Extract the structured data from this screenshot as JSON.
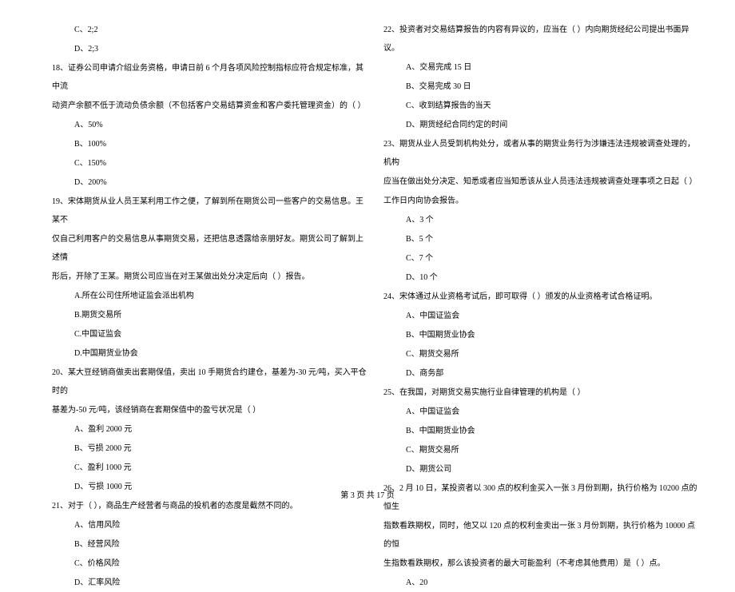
{
  "col_left": {
    "lead_opts": [
      "C、2;2",
      "D、2;3"
    ],
    "q18": {
      "stem_lines": [
        "18、证券公司申请介绍业务资格，申请日前 6 个月各项风险控制指标应符合规定标准，其中流",
        "动资产余额不低于流动负债余额（不包括客户交易结算资金和客户委托管理资金）的（    ）"
      ],
      "opts": [
        "A、50%",
        "B、100%",
        "C、150%",
        "D、200%"
      ]
    },
    "q19": {
      "stem_lines": [
        "19、宋体期货从业人员王某利用工作之便，了解到所在期货公司一些客户的交易信息。王某不",
        "仅自己利用客户的交易信息从事期货交易，还把信息透露给亲朋好友。期货公司了解到上述情",
        "形后，开除了王某。期货公司应当在对王某做出处分决定后向（    ）报告。"
      ],
      "opts": [
        "A.所在公司住所地证监会派出机构",
        "B.期货交易所",
        "C.中国证监会",
        "D.中国期货业协会"
      ]
    },
    "q20": {
      "stem_lines": [
        "20、某大豆经销商做卖出套期保值，卖出 10 手期货合约建仓，基差为-30 元/吨，买入平仓时的",
        "基差为-50 元/吨，该经销商在套期保值中的盈亏状况是（    ）"
      ],
      "opts": [
        "A、盈利 2000 元",
        "B、亏损 2000 元",
        "C、盈利 1000 元",
        "D、亏损 1000 元"
      ]
    },
    "q21": {
      "stem_lines": [
        "21、对于（    ），商品生产经营者与商品的投机者的态度是截然不同的。"
      ],
      "opts": [
        "A、信用风险",
        "B、经营风险",
        "C、价格风险",
        "D、汇率风险"
      ]
    }
  },
  "col_right": {
    "q22": {
      "stem_lines": [
        "22、投资者对交易结算报告的内容有异议的，应当在（    ）内向期货经纪公司提出书面异议。"
      ],
      "opts": [
        "A、交易完成 15 日",
        "B、交易完成 30 日",
        "C、收到结算报告的当天",
        "D、期货经纪合同约定的时间"
      ]
    },
    "q23": {
      "stem_lines": [
        "23、期货从业人员受到机构处分，或者从事的期货业务行为涉嫌违法违规被调查处理的，机构",
        "应当在做出处分决定、知悉或者应当知悉该从业人员违法违规被调查处理事项之日起（     ）",
        "工作日内向协会报告。"
      ],
      "opts": [
        "A、3 个",
        "B、5 个",
        "C、7 个",
        "D、10 个"
      ]
    },
    "q24": {
      "stem_lines": [
        "24、宋体通过从业资格考试后，即可取得（    ）颁发的从业资格考试合格证明。"
      ],
      "opts": [
        "A、中国证监会",
        "B、中国期货业协会",
        "C、期货交易所",
        "D、商务部"
      ]
    },
    "q25": {
      "stem_lines": [
        "25、在我国，对期货交易实施行业自律管理的机构是（    ）"
      ],
      "opts": [
        "A、中国证监会",
        "B、中国期货业协会",
        "C、期货交易所",
        "D、期货公司"
      ]
    },
    "q26": {
      "stem_lines": [
        "26、2 月 10 日，某投资者以 300 点的权利金买入一张 3 月份到期，执行价格为 10200 点的恒生",
        "指数看跌期权，同时，他又以 120 点的权利金卖出一张 3 月份到期，执行价格为 10000 点的恒",
        "生指数看跌期权，那么该投资者的最大可能盈利（不考虑其他费用）是（    ）点。"
      ],
      "opts": [
        "A、20"
      ]
    }
  },
  "footer": "第 3 页 共 17 页"
}
